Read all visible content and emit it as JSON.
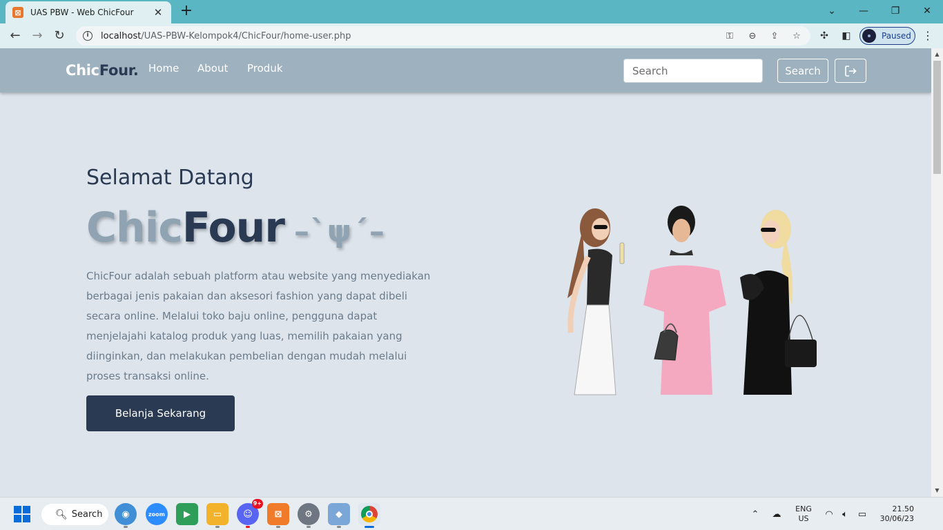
{
  "browser": {
    "tab": {
      "title": "UAS PBW - Web ChicFour",
      "favicon": "xampp-icon"
    },
    "url_host": "localhost",
    "url_path": "/UAS-PBW-Kelompok4/ChicFour/home-user.php",
    "profile_label": "Paused"
  },
  "nav": {
    "logo_light": "Chic",
    "logo_dark": "Four.",
    "links": [
      "Home",
      "About",
      "Produk"
    ],
    "search_placeholder": "Search",
    "search_button": "Search",
    "logout_icon": "logout-icon"
  },
  "hero": {
    "greeting": "Selamat Datang",
    "brand_light": "Chic",
    "brand_dark": "Four",
    "ornament": "–`ψ´–",
    "description": "ChicFour adalah sebuah platform atau website yang menyediakan berbagai jenis pakaian dan aksesori fashion yang dapat dibeli secara online. Melalui toko baju online, pengguna dapat menjelajahi katalog produk yang luas, memilih pakaian yang diinginkan, dan melakukan pembelian dengan mudah melalui proses transaksi online.",
    "cta": "Belanja Sekarang"
  },
  "taskbar": {
    "search_label": "Search",
    "discord_badge": "9+",
    "lang_primary": "ENG",
    "lang_secondary": "US",
    "time": "21.50",
    "date": "30/06/23"
  },
  "colors": {
    "nav_bg": "#9eb1bf",
    "page_bg": "#dde4ec",
    "brand_dark": "#2a3a52",
    "brand_light": "#8fa3b2",
    "tab_strip": "#5bb6c3"
  }
}
